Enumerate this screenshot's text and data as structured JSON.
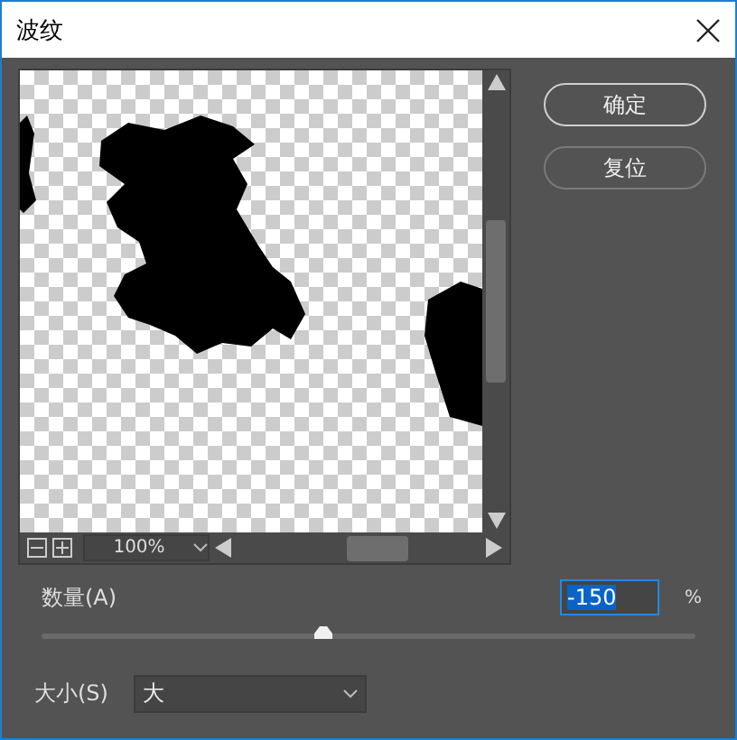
{
  "window": {
    "title": "波纹"
  },
  "buttons": [
    {
      "label": "确定",
      "default": true
    },
    {
      "label": "复位",
      "default": false
    }
  ],
  "preview": {
    "zoom": "100%"
  },
  "amount": {
    "label": "数量(A)",
    "value": "-150",
    "text_selected": true,
    "unit": "%",
    "level": 0.43
  },
  "size": {
    "label": "大小(S)",
    "value": "大"
  }
}
